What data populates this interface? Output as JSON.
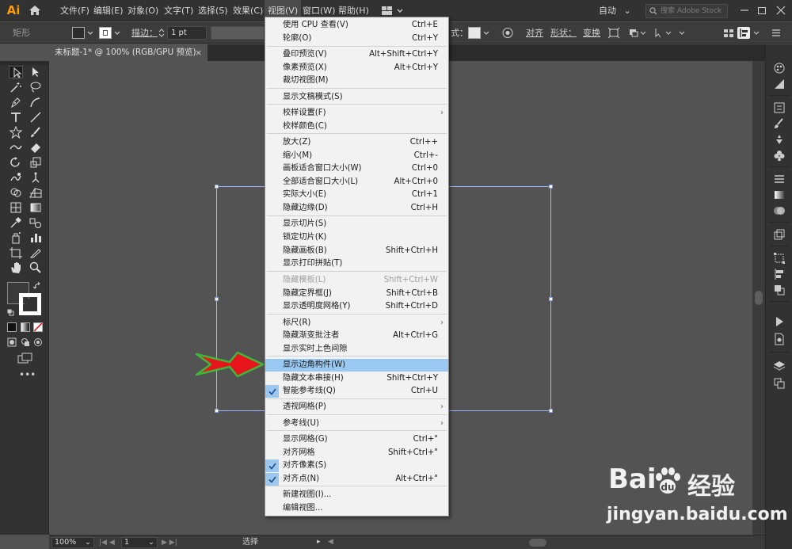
{
  "app": {
    "logo": "Ai",
    "workspace": "自动",
    "search_placeholder": "搜索 Adobe Stock"
  },
  "menubar": {
    "items": [
      "文件(F)",
      "编辑(E)",
      "对象(O)",
      "文字(T)",
      "选择(S)",
      "效果(C)",
      "视图(V)",
      "窗口(W)",
      "帮助(H)"
    ],
    "active_index": 6
  },
  "controlbar": {
    "tool_name": "矩形",
    "stroke_label": "描边：",
    "stroke_value": "1 pt",
    "style_label": "式：",
    "align_label": "对齐",
    "shape_label": "形状：",
    "transform_label": "变换"
  },
  "document": {
    "tab_title": "未标题-1* @ 100% (RGB/GPU 预览)",
    "close_glyph": "×"
  },
  "statusbar": {
    "zoom": "100%",
    "artboard_num": "1",
    "mode": "选择"
  },
  "view_menu": {
    "items": [
      {
        "label": "使用 CPU 查看(V)",
        "shortcut": "Ctrl+E"
      },
      {
        "label": "轮廓(O)",
        "shortcut": "Ctrl+Y"
      },
      {
        "label": "叠印预览(V)",
        "shortcut": "Alt+Shift+Ctrl+Y"
      },
      {
        "label": "像素预览(X)",
        "shortcut": "Alt+Ctrl+Y"
      },
      {
        "label": "裁切视图(M)",
        "shortcut": ""
      },
      {
        "label": "显示文稿模式(S)",
        "shortcut": ""
      },
      {
        "label": "校样设置(F)",
        "shortcut": "",
        "submenu": true
      },
      {
        "label": "校样颜色(C)",
        "shortcut": ""
      },
      {
        "label": "放大(Z)",
        "shortcut": "Ctrl++"
      },
      {
        "label": "缩小(M)",
        "shortcut": "Ctrl+-"
      },
      {
        "label": "画板适合窗口大小(W)",
        "shortcut": "Ctrl+0"
      },
      {
        "label": "全部适合窗口大小(L)",
        "shortcut": "Alt+Ctrl+0"
      },
      {
        "label": "实际大小(E)",
        "shortcut": "Ctrl+1"
      },
      {
        "label": "隐藏边缘(D)",
        "shortcut": "Ctrl+H"
      },
      {
        "label": "显示切片(S)",
        "shortcut": ""
      },
      {
        "label": "锁定切片(K)",
        "shortcut": ""
      },
      {
        "label": "隐藏画板(B)",
        "shortcut": "Shift+Ctrl+H"
      },
      {
        "label": "显示打印拼贴(T)",
        "shortcut": ""
      },
      {
        "label": "隐藏模板(L)",
        "shortcut": "Shift+Ctrl+W",
        "disabled": true
      },
      {
        "label": "隐藏定界框(J)",
        "shortcut": "Shift+Ctrl+B"
      },
      {
        "label": "显示透明度网格(Y)",
        "shortcut": "Shift+Ctrl+D"
      },
      {
        "label": "标尺(R)",
        "shortcut": "",
        "submenu": true
      },
      {
        "label": "隐藏渐变批注者",
        "shortcut": "Alt+Ctrl+G"
      },
      {
        "label": "显示实时上色间隙",
        "shortcut": ""
      },
      {
        "label": "显示边角构件(W)",
        "shortcut": "",
        "highlight": true
      },
      {
        "label": "隐藏文本串接(H)",
        "shortcut": "Shift+Ctrl+Y"
      },
      {
        "label": "智能参考线(Q)",
        "shortcut": "Ctrl+U",
        "checked": true
      },
      {
        "label": "透视网格(P)",
        "shortcut": "",
        "submenu": true
      },
      {
        "label": "参考线(U)",
        "shortcut": "",
        "submenu": true
      },
      {
        "label": "显示网格(G)",
        "shortcut": "Ctrl+\""
      },
      {
        "label": "对齐网格",
        "shortcut": "Shift+Ctrl+\""
      },
      {
        "label": "对齐像素(S)",
        "shortcut": "",
        "checked": true
      },
      {
        "label": "对齐点(N)",
        "shortcut": "Alt+Ctrl+\"",
        "checked": true
      },
      {
        "label": "新建视图(I)...",
        "shortcut": ""
      },
      {
        "label": "编辑视图...",
        "shortcut": ""
      }
    ]
  },
  "watermark": {
    "brand": "Bai",
    "suffix": "经验",
    "url": "jingyan.baidu.com"
  },
  "colors": {
    "highlight": "#99c9f2",
    "arrow": "#e8141c",
    "arrow_outline": "#3fb83a",
    "artboard": "#9db4ff"
  }
}
